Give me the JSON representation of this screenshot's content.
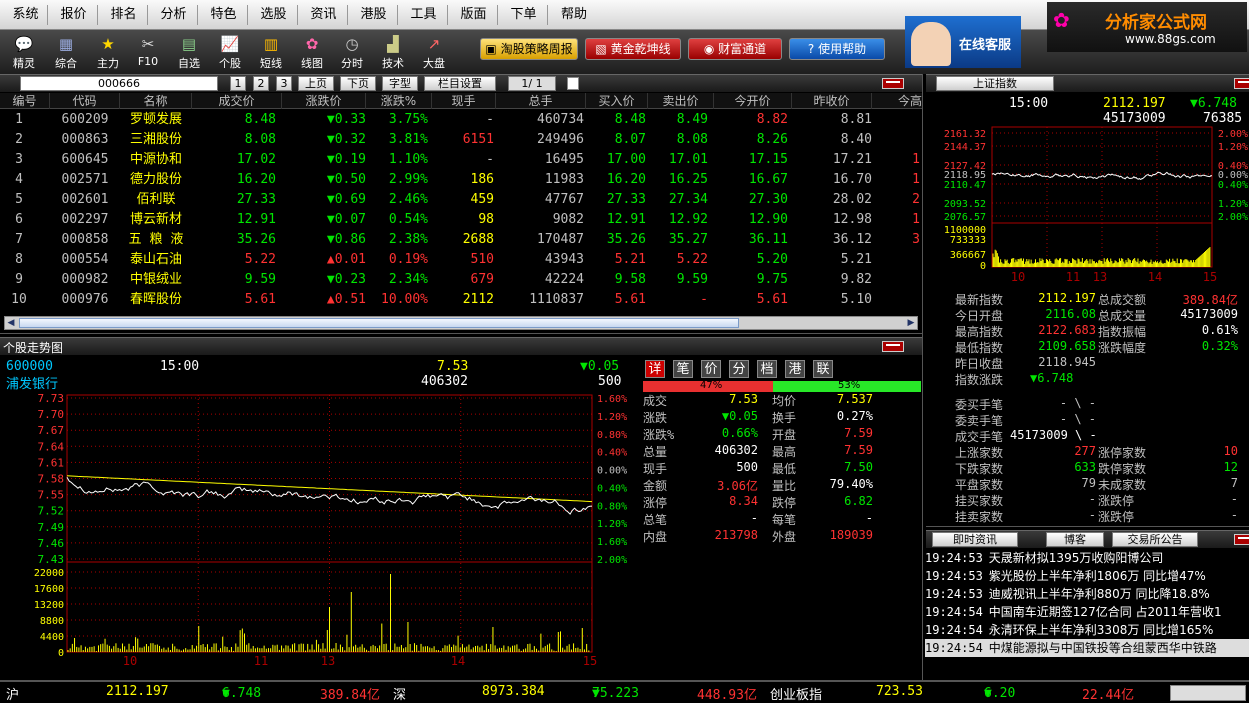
{
  "menu": [
    "系统",
    "报价",
    "排名",
    "分析",
    "特色",
    "选股",
    "资讯",
    "港股",
    "工具",
    "版面",
    "下单",
    "帮助"
  ],
  "toolbar": {
    "items": [
      {
        "label": "精灵",
        "icon": "chat-bubble-icon"
      },
      {
        "label": "综合",
        "icon": "table-icon"
      },
      {
        "label": "主力",
        "icon": "star-icon"
      },
      {
        "label": "F10",
        "icon": "tools-icon"
      },
      {
        "label": "自选",
        "icon": "folder-icon"
      },
      {
        "label": "个股",
        "icon": "line-chart-icon"
      },
      {
        "label": "短线",
        "icon": "bar-chart-icon"
      },
      {
        "label": "线图",
        "icon": "flower-icon"
      },
      {
        "label": "分时",
        "icon": "clock-icon"
      },
      {
        "label": "技术",
        "icon": "candle-icon"
      },
      {
        "label": "大盘",
        "icon": "trend-icon"
      }
    ],
    "buttons": [
      "淘股策略周报",
      "黄金乾坤线",
      "财富通道",
      "使用帮助"
    ],
    "service_label": "在线客服",
    "brand_text": "分析家公式网",
    "brand_url": "www.88gs.com"
  },
  "quote_panel": {
    "search_value": "000666",
    "pages": [
      "1",
      "2",
      "3"
    ],
    "prev": "上页",
    "next": "下页",
    "font": "字型",
    "columns_btn": "栏目设置",
    "page_info": "1/ 1",
    "headers": [
      "编号",
      "代码",
      "名称",
      "成交价",
      "涨跌价",
      "涨跌%",
      "现手",
      "总手",
      "买入价",
      "卖出价",
      "今开价",
      "昨收价",
      "今高"
    ],
    "rows": [
      {
        "no": "1",
        "code": "600209",
        "name": "罗顿发展",
        "price": "8.48",
        "dir": "down",
        "chg": "0.33",
        "pct": "3.75%",
        "vol": "-",
        "total": "460734",
        "bid": "8.48",
        "ask": "8.49",
        "open": "8.82",
        "prev": "8.81",
        "high": ""
      },
      {
        "no": "2",
        "code": "000863",
        "name": "三湘股份",
        "price": "8.08",
        "dir": "down",
        "chg": "0.32",
        "pct": "3.81%",
        "vol": "6151",
        "total": "249496",
        "bid": "8.07",
        "ask": "8.08",
        "open": "8.26",
        "prev": "8.40",
        "high": ""
      },
      {
        "no": "3",
        "code": "600645",
        "name": "中源协和",
        "price": "17.02",
        "dir": "down",
        "chg": "0.19",
        "pct": "1.10%",
        "vol": "-",
        "total": "16495",
        "bid": "17.00",
        "ask": "17.01",
        "open": "17.15",
        "prev": "17.21",
        "high": "1"
      },
      {
        "no": "4",
        "code": "002571",
        "name": "德力股份",
        "price": "16.20",
        "dir": "down",
        "chg": "0.50",
        "pct": "2.99%",
        "vol": "186",
        "total": "11983",
        "bid": "16.20",
        "ask": "16.25",
        "open": "16.67",
        "prev": "16.70",
        "high": "1"
      },
      {
        "no": "5",
        "code": "002601",
        "name": "佰利联",
        "price": "27.33",
        "dir": "down",
        "chg": "0.69",
        "pct": "2.46%",
        "vol": "459",
        "total": "47767",
        "bid": "27.33",
        "ask": "27.34",
        "open": "27.30",
        "prev": "28.02",
        "high": "2"
      },
      {
        "no": "6",
        "code": "002297",
        "name": "博云新材",
        "price": "12.91",
        "dir": "down",
        "chg": "0.07",
        "pct": "0.54%",
        "vol": "98",
        "total": "9082",
        "bid": "12.91",
        "ask": "12.92",
        "open": "12.90",
        "prev": "12.98",
        "high": "1"
      },
      {
        "no": "7",
        "code": "000858",
        "name": "五 粮 液",
        "price": "35.26",
        "dir": "down",
        "chg": "0.86",
        "pct": "2.38%",
        "vol": "2688",
        "total": "170487",
        "bid": "35.26",
        "ask": "35.27",
        "open": "36.11",
        "prev": "36.12",
        "high": "3"
      },
      {
        "no": "8",
        "code": "000554",
        "name": "泰山石油",
        "price": "5.22",
        "dir": "up",
        "chg": "0.01",
        "pct": "0.19%",
        "vol": "510",
        "total": "43943",
        "bid": "5.21",
        "ask": "5.22",
        "open": "5.20",
        "prev": "5.21",
        "high": ""
      },
      {
        "no": "9",
        "code": "000982",
        "name": "中银绒业",
        "price": "9.59",
        "dir": "down",
        "chg": "0.23",
        "pct": "2.34%",
        "vol": "679",
        "total": "42224",
        "bid": "9.58",
        "ask": "9.59",
        "open": "9.75",
        "prev": "9.82",
        "high": ""
      },
      {
        "no": "10",
        "code": "000976",
        "name": "春晖股份",
        "price": "5.61",
        "dir": "up",
        "chg": "0.51",
        "pct": "10.00%",
        "vol": "2112",
        "total": "1110837",
        "bid": "5.61",
        "ask": "-",
        "open": "5.61",
        "prev": "5.10",
        "high": ""
      }
    ]
  },
  "stock_chart": {
    "title": "个股走势图",
    "code": "600000",
    "name": "浦发银行",
    "time": "15:00",
    "price": "7.53",
    "change": "0.05",
    "volume": "406302",
    "lot": "500",
    "price_ticks": [
      "7.73",
      "7.70",
      "7.67",
      "7.64",
      "7.61",
      "7.58",
      "7.55",
      "7.52",
      "7.49",
      "7.46",
      "7.43"
    ],
    "pct_ticks": [
      "1.60%",
      "1.20%",
      "0.80%",
      "0.40%",
      "0.00%",
      "0.40%",
      "0.80%",
      "1.20%",
      "1.60%",
      "2.00%"
    ],
    "vol_ticks": [
      "22000",
      "17600",
      "13200",
      "8800",
      "4400",
      "0"
    ],
    "x_ticks": [
      "10",
      "11",
      "13",
      "14",
      "15"
    ]
  },
  "detail": {
    "tabs": [
      "详",
      "笔",
      "价",
      "分",
      "档",
      "港",
      "联"
    ],
    "buy_pct": "47%",
    "sell_pct": "53%",
    "rows": [
      [
        "成交",
        "7.53",
        "均价",
        "7.537"
      ],
      [
        "涨跌",
        "0.05",
        "换手",
        "0.27%"
      ],
      [
        "涨跌%",
        "0.66%",
        "开盘",
        "7.59"
      ],
      [
        "总量",
        "406302",
        "最高",
        "7.59"
      ],
      [
        "现手",
        "500",
        "最低",
        "7.50"
      ],
      [
        "金额",
        "3.06亿",
        "量比",
        "79.40%"
      ],
      [
        "涨停",
        "8.34",
        "跌停",
        "6.82"
      ],
      [
        "总笔",
        "-",
        "每笔",
        "-"
      ],
      [
        "内盘",
        "213798",
        "外盘",
        "189039"
      ]
    ]
  },
  "index": {
    "tab": "上证指数",
    "time": "15:00",
    "value": "2112.197",
    "change": "6.748",
    "volume": "45173009",
    "amount_short": "76385",
    "price_ticks": [
      "2161.32",
      "2144.37",
      "2127.42",
      "2118.95",
      "2110.47",
      "2093.52",
      "2076.57"
    ],
    "pct_ticks": [
      "2.00%",
      "1.20%",
      "0.40%",
      "0.00%",
      "0.40%",
      "1.20%",
      "2.00%"
    ],
    "vol_ticks": [
      "1100000",
      "733333",
      "366667",
      "0"
    ],
    "x_ticks": [
      "10",
      "11",
      "13",
      "14",
      "15"
    ],
    "stats": [
      [
        "最新指数",
        "2112.197",
        "总成交额",
        "389.84亿"
      ],
      [
        "今日开盘",
        "2116.08",
        "总成交量",
        "45173009"
      ],
      [
        "最高指数",
        "2122.683",
        "指数振幅",
        "0.61%"
      ],
      [
        "最低指数",
        "2109.658",
        "涨跌幅度",
        "0.32%"
      ],
      [
        "昨日收盘",
        "2118.945",
        "",
        ""
      ],
      [
        "指数涨跌",
        "6.748",
        "",
        ""
      ]
    ],
    "stats2": [
      [
        "委买手笔",
        "- \\ -",
        "",
        ""
      ],
      [
        "委卖手笔",
        "- \\ -",
        "",
        ""
      ],
      [
        "成交手笔",
        "45173009 \\ -",
        "",
        ""
      ],
      [
        "上涨家数",
        "277",
        "涨停家数",
        "10"
      ],
      [
        "下跌家数",
        "633",
        "跌停家数",
        "12"
      ],
      [
        "平盘家数",
        "79",
        "未成家数",
        "7"
      ],
      [
        "挂买家数",
        "-",
        "涨跌停",
        "-"
      ],
      [
        "挂卖家数",
        "-",
        "涨跌停",
        "-"
      ]
    ]
  },
  "news": {
    "tabs": [
      "即时资讯",
      "博客",
      "交易所公告"
    ],
    "items": [
      [
        "19:24:53",
        "天晟新材拟1395万收购阳博公司"
      ],
      [
        "19:24:53",
        "紫光股份上半年净利1806万 同比增47%"
      ],
      [
        "19:24:53",
        "迪威视讯上半年净利880万 同比降18.8%"
      ],
      [
        "19:24:54",
        "中国南车近期签127亿合同 占2011年营收1"
      ],
      [
        "19:24:54",
        "永清环保上半年净利3308万 同比增165%"
      ],
      [
        "19:24:54",
        "中煤能源拟与中国铁投等合组蒙西华中铁路"
      ]
    ]
  },
  "status": {
    "sh_label": "沪",
    "sh_value": "2112.197",
    "sh_change": "6.748",
    "sh_amount": "389.84亿",
    "sz_label": "深",
    "sz_value": "8973.384",
    "sz_change": "75.223",
    "sz_amount": "448.93亿",
    "cy_label": "创业板指",
    "cy_value": "723.53",
    "cy_change": "6.20",
    "cy_amount": "22.44亿"
  }
}
